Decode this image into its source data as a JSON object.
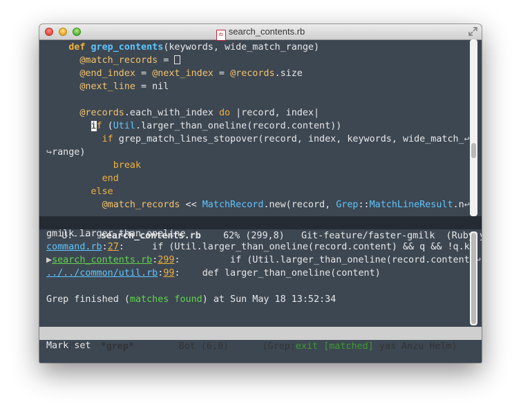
{
  "window": {
    "title": "search_contents.rb",
    "file_icon_label": "rb"
  },
  "editor": {
    "lines": [
      {
        "t": [
          [
            "    ",
            ""
          ],
          [
            "def",
            "kw"
          ],
          [
            " ",
            ""
          ],
          [
            "grep_contents",
            "fn"
          ],
          [
            "(keywords, wide_match_range)",
            ""
          ]
        ]
      },
      {
        "t": [
          [
            "      ",
            ""
          ],
          [
            "@match_records",
            "iv"
          ],
          [
            " = ",
            ""
          ],
          [
            "[]",
            "box"
          ]
        ]
      },
      {
        "t": [
          [
            "      ",
            ""
          ],
          [
            "@end_index",
            "iv"
          ],
          [
            " = ",
            ""
          ],
          [
            "@next_index",
            "iv"
          ],
          [
            " = ",
            ""
          ],
          [
            "@records",
            "iv"
          ],
          [
            ".size",
            ""
          ]
        ]
      },
      {
        "t": [
          [
            "      ",
            ""
          ],
          [
            "@next_line",
            "iv"
          ],
          [
            " = nil",
            ""
          ]
        ]
      },
      {
        "t": []
      },
      {
        "t": [
          [
            "      ",
            ""
          ],
          [
            "@records",
            "iv"
          ],
          [
            ".each_with_index ",
            ""
          ],
          [
            "do",
            "kwn"
          ],
          [
            " |record, index|",
            ""
          ]
        ]
      },
      {
        "t": [
          [
            "        ",
            ""
          ],
          [
            "i",
            "cursor"
          ],
          [
            "f",
            "kwn"
          ],
          [
            " (",
            ""
          ],
          [
            "Util",
            "cst"
          ],
          [
            ".larger_than_oneline(record.content))",
            ""
          ]
        ]
      },
      {
        "t": [
          [
            "          ",
            ""
          ],
          [
            "if",
            "kwn"
          ],
          [
            " grep_match_lines_stopover(record, index, keywords, wide_match_",
            ""
          ],
          [
            "↩",
            "glyph"
          ]
        ]
      },
      {
        "t": [
          [
            "↪",
            "glyph"
          ],
          [
            "range)",
            ""
          ]
        ]
      },
      {
        "t": [
          [
            "            ",
            ""
          ],
          [
            "break",
            "kwn"
          ]
        ]
      },
      {
        "t": [
          [
            "          ",
            ""
          ],
          [
            "end",
            "kwn"
          ]
        ]
      },
      {
        "t": [
          [
            "        ",
            ""
          ],
          [
            "else",
            "kwn"
          ]
        ]
      },
      {
        "t": [
          [
            "          ",
            ""
          ],
          [
            "@match_records",
            "iv"
          ],
          [
            " << ",
            ""
          ],
          [
            "MatchRecord",
            "cst"
          ],
          [
            ".new(record, ",
            ""
          ],
          [
            "Grep",
            "cst"
          ],
          [
            "::",
            ""
          ],
          [
            "MatchLineResult",
            "cst"
          ],
          [
            ".n",
            ""
          ],
          [
            "↩",
            "glyph"
          ]
        ]
      }
    ],
    "scrollbar": {
      "thumb_position": 0.62
    }
  },
  "modeline_top": {
    "state": "U:---",
    "buffer": "search_contents.rb",
    "position": "62% (299,8)",
    "vc": "Git-feature/faster-gmilk",
    "modes": "(Ruby yas"
  },
  "grep": {
    "lines": [
      {
        "t": [
          [
            "gmilk larger_than_oneline",
            ""
          ]
        ]
      },
      {
        "t": [
          [
            "command.rb",
            "lnk"
          ],
          [
            ":",
            ""
          ],
          [
            "27",
            "num"
          ],
          [
            ":",
            ""
          ],
          [
            "     if (Util.larger_than_oneline(record.content) && q && !q.k",
            ""
          ],
          [
            "↩",
            "glyph"
          ]
        ]
      },
      {
        "t": [
          [
            "▶",
            "glyph"
          ],
          [
            "search_contents.rb",
            "grnu"
          ],
          [
            ":",
            ""
          ],
          [
            "299",
            "num"
          ],
          [
            ":",
            ""
          ],
          [
            "         if (Util.larger_than_oneline(record.content)",
            ""
          ],
          [
            "↩",
            "glyph"
          ]
        ]
      },
      {
        "t": [
          [
            "../../common/util.rb",
            "lnk"
          ],
          [
            ":",
            ""
          ],
          [
            "99",
            "num"
          ],
          [
            ":",
            ""
          ],
          [
            "    def larger_than_oneline(content)",
            ""
          ]
        ]
      },
      {
        "t": []
      },
      {
        "t": [
          [
            "Grep finished (",
            ""
          ],
          [
            "matches found",
            "grn"
          ],
          [
            ") at Sun May 18 13:52:34",
            ""
          ]
        ]
      }
    ]
  },
  "modeline_bottom": {
    "state": "U:%*-",
    "buffer": "*grep*",
    "position": "Bot (6,0)",
    "modes_prefix": "(Grep:",
    "exit": "exit",
    "matched": "[matched]",
    "modes_suffix": "yas Anzu Helm)"
  },
  "minibuffer": {
    "message": "Mark set"
  }
}
